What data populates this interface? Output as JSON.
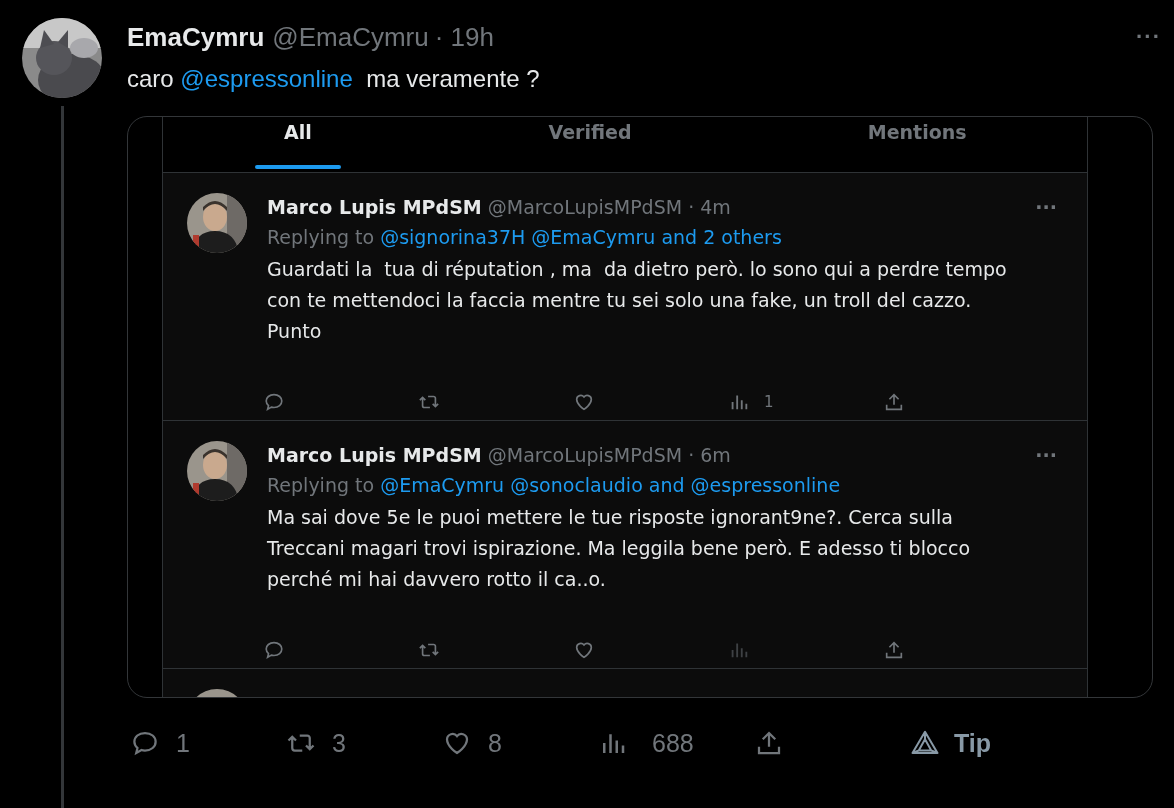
{
  "tweet": {
    "name": "EmaCymru",
    "handle": "@EmaCymru",
    "time": "· 19h",
    "more": "···",
    "text": [
      {
        "kind": "plain",
        "text": "caro "
      },
      {
        "kind": "mention",
        "text": "@espressonline"
      },
      {
        "kind": "plain",
        "text": "  ma veramente ?"
      }
    ],
    "screenshot": {
      "tabs": [
        {
          "label": "All",
          "selected": true
        },
        {
          "label": "Verified",
          "selected": false
        },
        {
          "label": "Mentions",
          "selected": false
        }
      ],
      "replies": [
        {
          "name": "Marco Lupis MPdSM",
          "handle": "@MarcoLupisMPdSM",
          "time": "· 4m",
          "more": "···",
          "replying_prefix": "Replying to",
          "replying_to": "@signorina37H @EmaCymru and 2 others",
          "body": "Guardati la  tua di réputation , ma  da dietro però. lo sono qui a perdre tempo con te mettendoci la faccia mentre tu sei solo una fake, un troll del cazzo. Punto",
          "actions": [
            {
              "kind": "reply",
              "disabled": false
            },
            {
              "kind": "retweet",
              "disabled": false
            },
            {
              "kind": "like",
              "disabled": false
            },
            {
              "kind": "views",
              "disabled": false,
              "count": "1"
            },
            {
              "kind": "share",
              "disabled": false
            }
          ]
        },
        {
          "name": "Marco Lupis MPdSM",
          "handle": "@MarcoLupisMPdSM",
          "time": "· 6m",
          "more": "···",
          "replying_prefix": "Replying to",
          "replying_to": "@EmaCymru @sonoclaudio and @espressonline",
          "body": "Ma sai dove 5e le puoi mettere le tue risposte ignorant9ne?. Cerca sulla Treccani magari trovi ispirazione. Ma leggila bene però. E adesso ti blocco perché mi hai davvero rotto il ca..o.",
          "actions": [
            {
              "kind": "reply",
              "disabled": false
            },
            {
              "kind": "retweet",
              "disabled": false
            },
            {
              "kind": "like",
              "disabled": false
            },
            {
              "kind": "views",
              "disabled": true
            },
            {
              "kind": "share",
              "disabled": false
            }
          ]
        }
      ]
    },
    "actions": [
      {
        "kind": "reply",
        "count": "1"
      },
      {
        "kind": "retweet",
        "count": "3"
      },
      {
        "kind": "like",
        "count": "8"
      },
      {
        "kind": "views",
        "count": "688"
      },
      {
        "kind": "share"
      },
      {
        "kind": "tip",
        "label": "Tip"
      }
    ]
  }
}
